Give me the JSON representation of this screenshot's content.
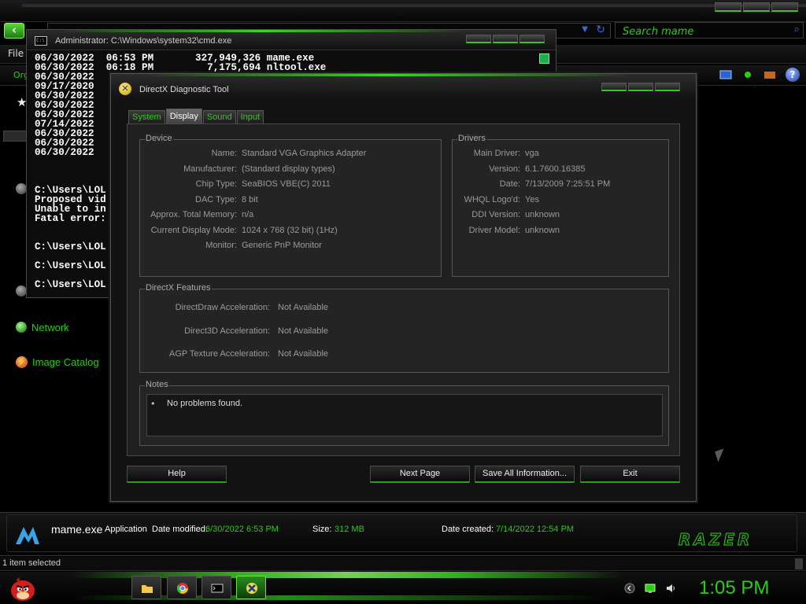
{
  "explorer": {
    "menu_file": "File",
    "organize": "Org",
    "search_placeholder": "Search mame",
    "nav": {
      "network": "Network",
      "image_catalog": "Image Catalog"
    }
  },
  "cmd": {
    "title": "Administrator: C:\\Windows\\system32\\cmd.exe",
    "icon_text": "C:\\",
    "lines": [
      "06/30/2022  06:53 PM       327,949,326 mame.exe",
      "06/30/2022  06:18 PM         7,175,694 nltool.exe",
      "06/30/2022",
      "09/17/2020",
      "06/30/2022",
      "06/30/2022",
      "06/30/2022",
      "07/14/2022",
      "06/30/2022",
      "06/30/2022",
      "06/30/2022",
      "",
      "",
      "",
      "C:\\Users\\LOL",
      "Proposed vid",
      "Unable to in",
      "Fatal error:",
      "",
      "",
      "C:\\Users\\LOL",
      "",
      "C:\\Users\\LOL",
      "",
      "C:\\Users\\LOL"
    ]
  },
  "dxdiag": {
    "title": "DirectX Diagnostic Tool",
    "tabs": [
      "System",
      "Display",
      "Sound",
      "Input"
    ],
    "active_tab": "Display",
    "device": {
      "title": "Device",
      "rows": [
        {
          "label": "Name:",
          "value": "Standard VGA Graphics Adapter"
        },
        {
          "label": "Manufacturer:",
          "value": "(Standard display types)"
        },
        {
          "label": "Chip Type:",
          "value": "SeaBIOS VBE(C) 2011"
        },
        {
          "label": "DAC Type:",
          "value": "8 bit"
        },
        {
          "label": "Approx. Total Memory:",
          "value": "n/a"
        },
        {
          "label": "Current Display Mode:",
          "value": "1024 x 768 (32 bit) (1Hz)"
        },
        {
          "label": "Monitor:",
          "value": "Generic PnP Monitor"
        }
      ]
    },
    "drivers": {
      "title": "Drivers",
      "rows": [
        {
          "label": "Main Driver:",
          "value": "vga"
        },
        {
          "label": "Version:",
          "value": "6.1.7600.16385"
        },
        {
          "label": "Date:",
          "value": "7/13/2009 7:25:51 PM"
        },
        {
          "label": "WHQL Logo'd:",
          "value": "Yes"
        },
        {
          "label": "DDI Version:",
          "value": "unknown"
        },
        {
          "label": "Driver Model:",
          "value": "unknown"
        }
      ]
    },
    "features": {
      "title": "DirectX Features",
      "rows": [
        {
          "label": "DirectDraw Acceleration:",
          "value": "Not Available"
        },
        {
          "label": "Direct3D Acceleration:",
          "value": "Not Available"
        },
        {
          "label": "AGP Texture Acceleration:",
          "value": "Not Available"
        }
      ]
    },
    "notes": {
      "title": "Notes",
      "bullet": "•",
      "text": "No problems found."
    },
    "buttons": {
      "help": "Help",
      "next_page": "Next Page",
      "save_all": "Save All Information...",
      "exit": "Exit"
    }
  },
  "details": {
    "name": "mame.exe",
    "type": "Application",
    "date_modified_label": "Date modified:",
    "date_modified": "6/30/2022 6:53 PM",
    "size_label": "Size:",
    "size": "312 MB",
    "date_created_label": "Date created:",
    "date_created": "7/14/2022 12:54 PM",
    "brand": "RAZER"
  },
  "status": {
    "text": "1 item selected"
  },
  "taskbar": {
    "clock": "1:05 PM",
    "apps": [
      "file-explorer",
      "chrome",
      "command-prompt",
      "directx-diagnostic"
    ]
  },
  "colors": {
    "accent_green": "#2ccc16",
    "glow_green": "#3cd621",
    "text_gray": "#9a9a9a"
  }
}
